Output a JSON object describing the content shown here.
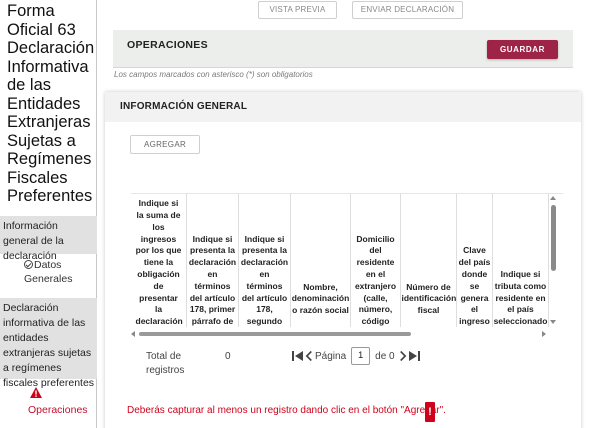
{
  "sidebar": {
    "form_title": "Forma Oficial 63 Declaración Informativa de las Entidades Extranjeras Sujetas a Regímenes Fiscales Preferentes",
    "items": [
      {
        "label": "Información general de la declaración"
      },
      {
        "label": "Datos Generales"
      },
      {
        "label": "Declaración informativa de las entidades extranjeras sujetas a regímenes fiscales preferentes"
      },
      {
        "label": "Operaciones"
      }
    ]
  },
  "toolbar": {
    "preview_label": "VISTA PREVIA",
    "send_label": "ENVIAR DECLARACIÓN"
  },
  "operations": {
    "title": "OPERACIONES",
    "save_label": "GUARDAR",
    "required_note": "Los campos marcados con asterisco (*) son obligatorios"
  },
  "info": {
    "title": "INFORMACIÓN GENERAL",
    "add_label": "AGREGAR",
    "columns": [
      "Indique si la suma de los ingresos por los que tiene la obligación de presentar la declaración",
      "Indique si presenta la declaración en términos del artículo 178, primer párrafo de",
      "Indique si presenta la declaración en términos del artículo 178, segundo",
      "Nombre, denominación o razón social",
      "Domicilio del residente en el extranjero (calle, número, código",
      "Número de identificación fiscal",
      "Clave del país donde se genera el ingreso",
      "Indique si tributa como residente en el país seleccionado"
    ],
    "total_label": "Total de registros",
    "total_value": "0",
    "page_label": "Página",
    "page_value": "1",
    "of_label": "de 0"
  },
  "error": {
    "message": "Deberás capturar al menos un registro dando clic en el botón \"Agregar\".",
    "badge": "!"
  },
  "colors": {
    "accent": "#9d2447",
    "error": "#d0021b",
    "sidebar_active": "#e1e1e1"
  }
}
